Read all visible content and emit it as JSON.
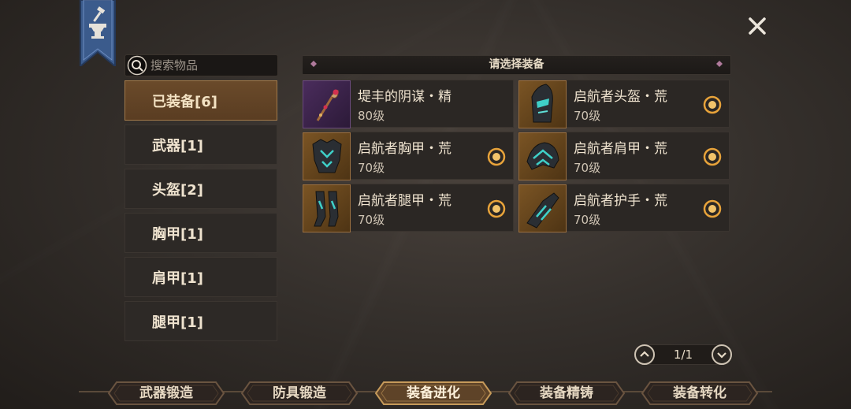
{
  "search": {
    "placeholder": "搜索物品"
  },
  "categories": [
    {
      "label": "已装备[6]",
      "active": true
    },
    {
      "label": "武器[1]"
    },
    {
      "label": "头盔[2]"
    },
    {
      "label": "胸甲[1]"
    },
    {
      "label": "肩甲[1]"
    },
    {
      "label": "腿甲[1]"
    }
  ],
  "list": {
    "header": "请选择装备",
    "items": [
      {
        "name": "堤丰的阴谋・精",
        "level": "80级",
        "icon": "staff-icon",
        "frame": "purple",
        "marked": false
      },
      {
        "name": "启航者头盔・荒",
        "level": "70级",
        "icon": "helmet-icon",
        "frame": "gold",
        "marked": true
      },
      {
        "name": "启航者胸甲・荒",
        "level": "70级",
        "icon": "chestplate-icon",
        "frame": "gold",
        "marked": true
      },
      {
        "name": "启航者肩甲・荒",
        "level": "70级",
        "icon": "shoulder-armor-icon",
        "frame": "gold",
        "marked": true
      },
      {
        "name": "启航者腿甲・荒",
        "level": "70级",
        "icon": "leg-armor-icon",
        "frame": "gold",
        "marked": true
      },
      {
        "name": "启航者护手・荒",
        "level": "70级",
        "icon": "gauntlet-icon",
        "frame": "gold",
        "marked": true
      }
    ]
  },
  "pager": {
    "text": "1/1"
  },
  "tabs": [
    {
      "label": "武器锻造"
    },
    {
      "label": "防具锻造"
    },
    {
      "label": "装备进化",
      "active": true
    },
    {
      "label": "装备精铸"
    },
    {
      "label": "装备转化"
    }
  ],
  "colors": {
    "accent_gold": "#e8a33a",
    "active_tab_bg": "#6a4a2a"
  }
}
